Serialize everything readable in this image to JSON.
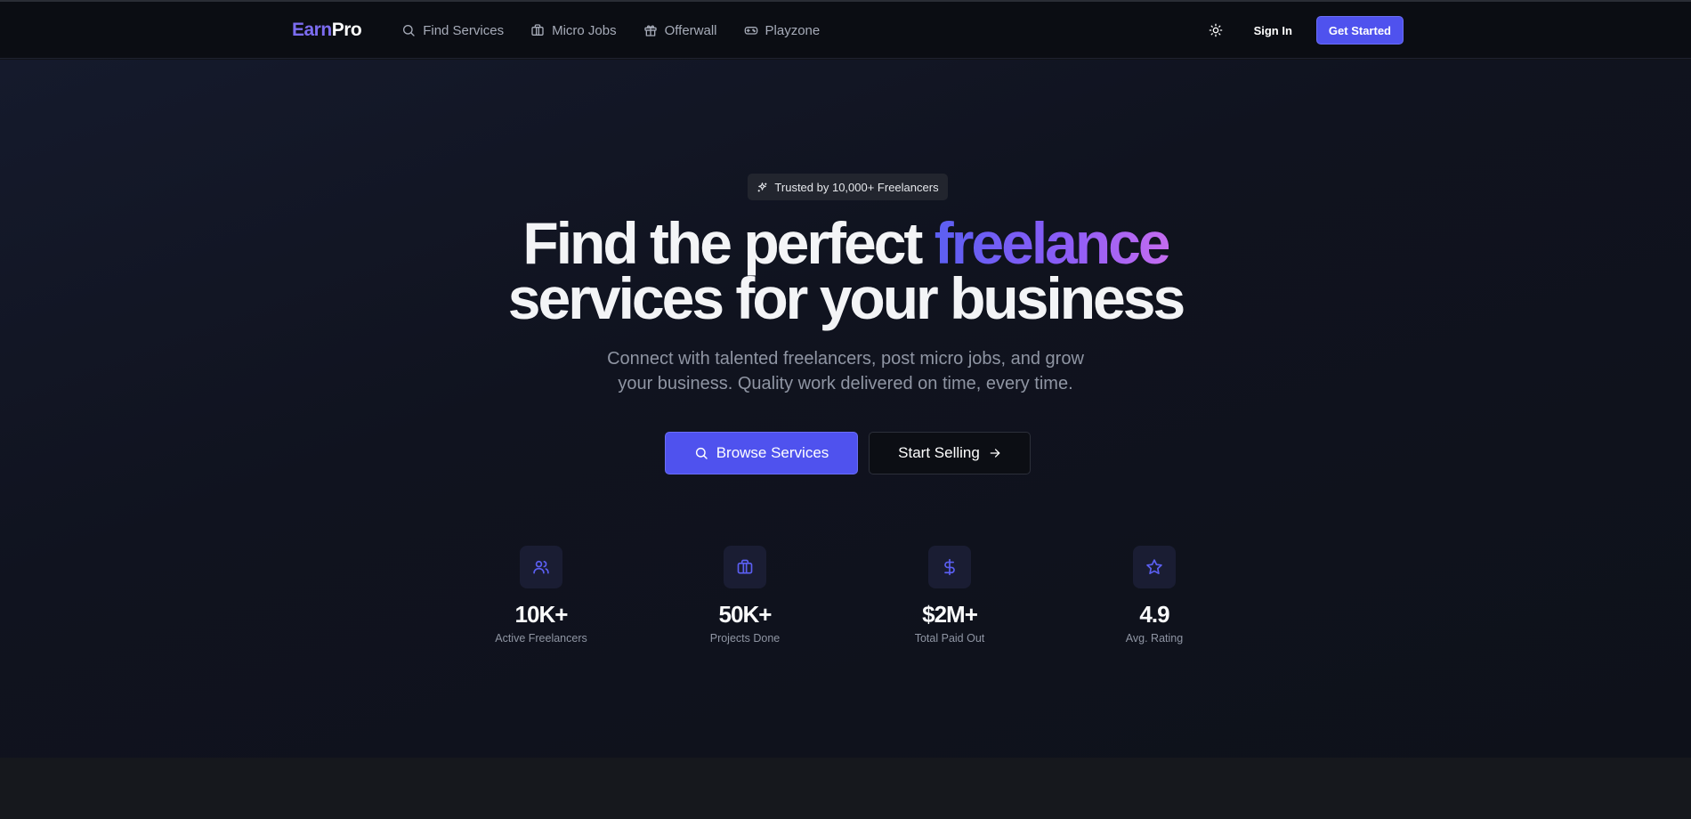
{
  "brand": {
    "part1": "Earn",
    "part2": "Pro"
  },
  "nav": {
    "items": [
      {
        "label": "Find Services",
        "icon": "search-icon"
      },
      {
        "label": "Micro Jobs",
        "icon": "briefcase-icon"
      },
      {
        "label": "Offerwall",
        "icon": "gift-icon"
      },
      {
        "label": "Playzone",
        "icon": "gamepad-icon"
      }
    ],
    "theme_icon": "sun-icon",
    "sign_in": "Sign In",
    "get_started": "Get Started"
  },
  "hero": {
    "badge": "Trusted by 10,000+ Freelancers",
    "headline_part1": "Find the perfect ",
    "headline_highlight": "freelance",
    "headline_line2": "services for your business",
    "subtext_line1": "Connect with talented freelancers, post micro jobs, and grow",
    "subtext_line2": "your business. Quality work delivered on time, every time.",
    "primary_button": "Browse Services",
    "secondary_button": "Start Selling"
  },
  "stats": [
    {
      "value": "10K+",
      "label": "Active Freelancers",
      "icon": "users-icon"
    },
    {
      "value": "50K+",
      "label": "Projects Done",
      "icon": "briefcase-icon"
    },
    {
      "value": "$2M+",
      "label": "Total Paid Out",
      "icon": "dollar-icon"
    },
    {
      "value": "4.9",
      "label": "Avg. Rating",
      "icon": "star-icon"
    }
  ],
  "colors": {
    "accent": "#4f52ee",
    "logo_accent": "#7c6cf0",
    "gradient_start": "#5b5ff2",
    "gradient_end": "#c46cf0",
    "background": "#111318"
  }
}
